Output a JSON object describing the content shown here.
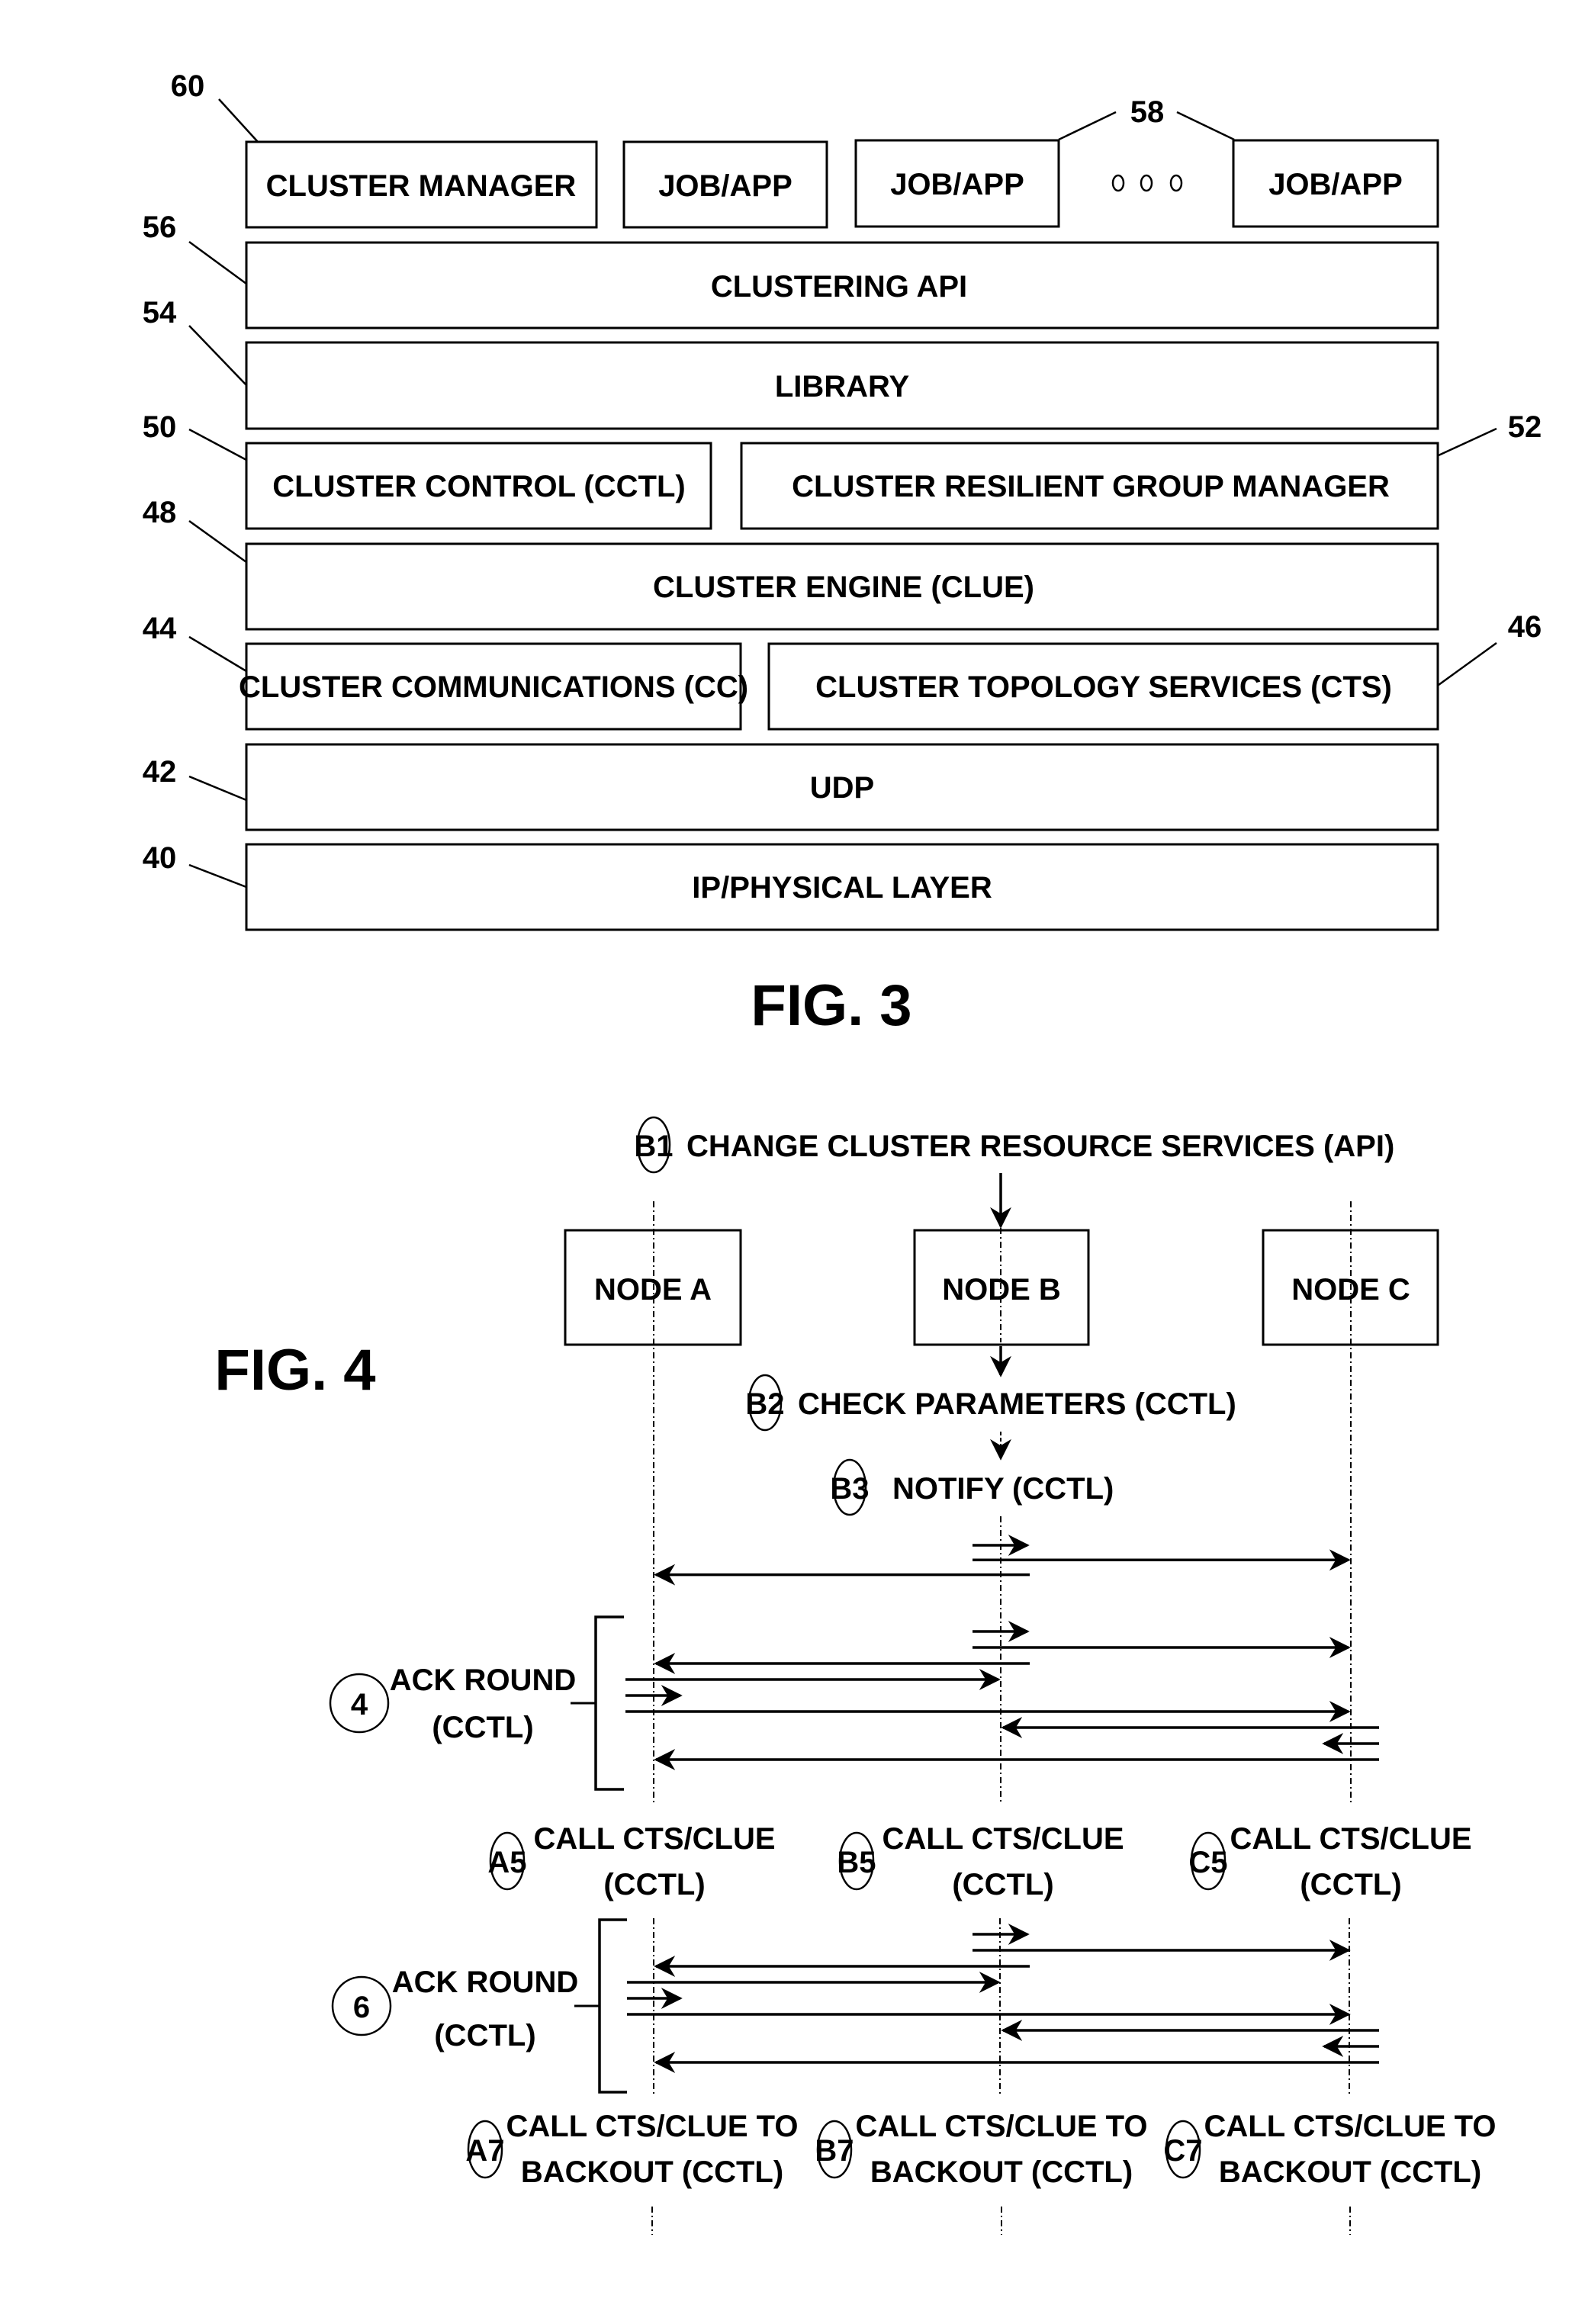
{
  "fig3": {
    "title": "FIG. 3",
    "layers": [
      {
        "ref": "60",
        "label": "CLUSTER MANAGER"
      },
      {
        "ref": "58",
        "label": "JOB/APP"
      },
      {
        "ref": "58",
        "label": "JOB/APP"
      },
      {
        "ref": "58",
        "label": "JOB/APP"
      },
      {
        "ref": "56",
        "label": "CLUSTERING API"
      },
      {
        "ref": "54",
        "label": "LIBRARY"
      },
      {
        "ref": "50",
        "label": "CLUSTER CONTROL (CCTL)"
      },
      {
        "ref": "52",
        "label": "CLUSTER RESILIENT GROUP MANAGER"
      },
      {
        "ref": "48",
        "label": "CLUSTER ENGINE (CLUE)"
      },
      {
        "ref": "44",
        "label": "CLUSTER COMMUNICATIONS (CC)"
      },
      {
        "ref": "46",
        "label": "CLUSTER TOPOLOGY SERVICES (CTS)"
      },
      {
        "ref": "42",
        "label": "UDP"
      },
      {
        "ref": "40",
        "label": "IP/PHYSICAL LAYER"
      }
    ],
    "ellipsis": "ooo",
    "refs": {
      "r60": "60",
      "r58": "58",
      "r56": "56",
      "r54": "54",
      "r50": "50",
      "r52": "52",
      "r48": "48",
      "r44": "44",
      "r46": "46",
      "r42": "42",
      "r40": "40"
    }
  },
  "fig4": {
    "title": "FIG. 4",
    "nodes": [
      "NODE A",
      "NODE B",
      "NODE C"
    ],
    "steps": {
      "b1": {
        "tag": "B1",
        "text": "CHANGE CLUSTER RESOURCE SERVICES (API)"
      },
      "b2": {
        "tag": "B2",
        "text": "CHECK PARAMETERS (CCTL)"
      },
      "b3": {
        "tag": "B3",
        "text": "NOTIFY (CCTL)"
      },
      "r4": {
        "tag": "4",
        "line1": "ACK ROUND",
        "line2": "(CCTL)"
      },
      "a5": {
        "tag": "A5",
        "line1": "CALL CTS/CLUE",
        "line2": "(CCTL)"
      },
      "b5": {
        "tag": "B5",
        "line1": "CALL CTS/CLUE",
        "line2": "(CCTL)"
      },
      "c5": {
        "tag": "C5",
        "line1": "CALL CTS/CLUE",
        "line2": "(CCTL)"
      },
      "r6": {
        "tag": "6",
        "line1": "ACK ROUND",
        "line2": "(CCTL)"
      },
      "a7": {
        "tag": "A7",
        "line1": "CALL CTS/CLUE TO",
        "line2": "BACKOUT (CCTL)"
      },
      "b7": {
        "tag": "B7",
        "line1": "CALL CTS/CLUE TO",
        "line2": "BACKOUT (CCTL)"
      },
      "c7": {
        "tag": "C7",
        "line1": "CALL CTS/CLUE TO",
        "line2": "BACKOUT (CCTL)"
      }
    },
    "messages": [
      {
        "group": "notify",
        "from": "B",
        "to": "B",
        "kind": "self"
      },
      {
        "group": "notify",
        "from": "B",
        "to": "C"
      },
      {
        "group": "notify",
        "from": "B",
        "to": "A"
      },
      {
        "group": "ack4",
        "from": "B",
        "to": "B",
        "kind": "self"
      },
      {
        "group": "ack4",
        "from": "B",
        "to": "C"
      },
      {
        "group": "ack4",
        "from": "B",
        "to": "A"
      },
      {
        "group": "ack4",
        "from": "A",
        "to": "B"
      },
      {
        "group": "ack4",
        "from": "A",
        "to": "A",
        "kind": "self"
      },
      {
        "group": "ack4",
        "from": "A",
        "to": "C"
      },
      {
        "group": "ack4",
        "from": "C",
        "to": "B"
      },
      {
        "group": "ack4",
        "from": "C",
        "to": "C",
        "kind": "self"
      },
      {
        "group": "ack4",
        "from": "C",
        "to": "A"
      },
      {
        "group": "ack6",
        "from": "B",
        "to": "B",
        "kind": "self"
      },
      {
        "group": "ack6",
        "from": "B",
        "to": "C"
      },
      {
        "group": "ack6",
        "from": "B",
        "to": "A"
      },
      {
        "group": "ack6",
        "from": "A",
        "to": "B"
      },
      {
        "group": "ack6",
        "from": "A",
        "to": "A",
        "kind": "self"
      },
      {
        "group": "ack6",
        "from": "A",
        "to": "C"
      },
      {
        "group": "ack6",
        "from": "C",
        "to": "B"
      },
      {
        "group": "ack6",
        "from": "C",
        "to": "C",
        "kind": "self"
      },
      {
        "group": "ack6",
        "from": "C",
        "to": "A"
      }
    ]
  }
}
